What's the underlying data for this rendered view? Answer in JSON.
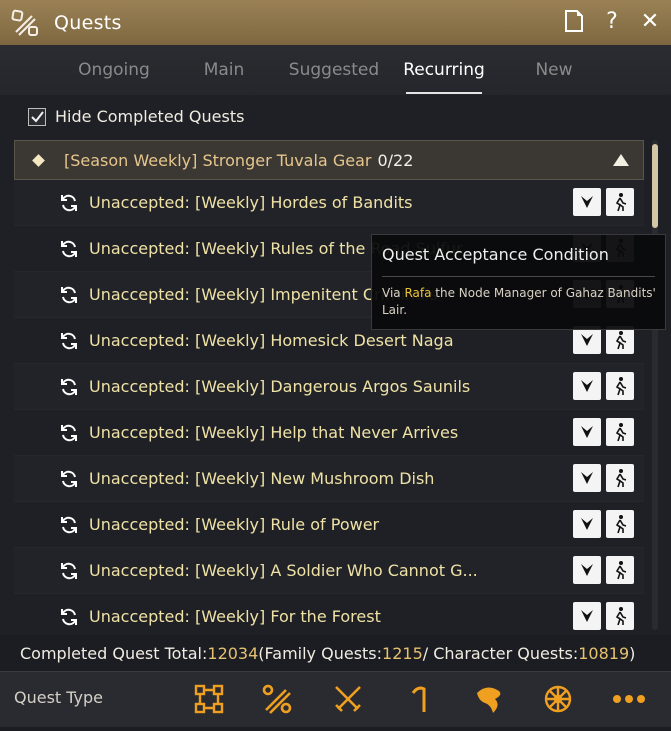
{
  "window": {
    "title": "Quests"
  },
  "tabs": [
    {
      "label": "Ongoing",
      "active": false
    },
    {
      "label": "Main",
      "active": false
    },
    {
      "label": "Suggested",
      "active": false
    },
    {
      "label": "Recurring",
      "active": true
    },
    {
      "label": "New",
      "active": false
    }
  ],
  "filter": {
    "hide_completed_label": "Hide Completed Quests",
    "checked": true
  },
  "group": {
    "title": "[Season Weekly] Stronger Tuvala Gear",
    "count": "0/22"
  },
  "quests": [
    {
      "name": "Unaccepted: [Weekly] Hordes of Bandits"
    },
    {
      "name": "Unaccepted: [Weekly] Rules of the Road Sulfur"
    },
    {
      "name": "Unaccepted: [Weekly] Impenitent Criminals"
    },
    {
      "name": "Unaccepted: [Weekly] Homesick Desert Naga"
    },
    {
      "name": "Unaccepted: [Weekly] Dangerous Argos Saunils"
    },
    {
      "name": "Unaccepted: [Weekly] Help that Never Arrives"
    },
    {
      "name": "Unaccepted: [Weekly] New Mushroom Dish"
    },
    {
      "name": "Unaccepted: [Weekly] Rule of Power"
    },
    {
      "name": "Unaccepted: [Weekly] A Soldier Who Cannot G..."
    },
    {
      "name": "Unaccepted: [Weekly] For the Forest"
    }
  ],
  "tooltip": {
    "title": "Quest Acceptance Condition",
    "prefix": "Via ",
    "npc": "Rafa",
    "suffix": " the Node Manager of Gahaz Bandits' Lair."
  },
  "totals": {
    "label": "Completed Quest Total: ",
    "total": "12034",
    "family_label": " (Family Quests: ",
    "family": "1215",
    "char_label": " / Character Quests: ",
    "character": "10819",
    "close": ")"
  },
  "quest_type": {
    "label": "Quest Type",
    "icons": [
      "all-types-icon",
      "scroll-tools-icon",
      "crossed-swords-icon",
      "fishing-rod-icon",
      "fish-icon",
      "ship-wheel-icon",
      "more-icon"
    ],
    "icon_color": "#f0a020"
  },
  "colors": {
    "titlebar": "#8d7449",
    "quest_text": "#efe2a6",
    "highlight": "#e9c43c"
  }
}
